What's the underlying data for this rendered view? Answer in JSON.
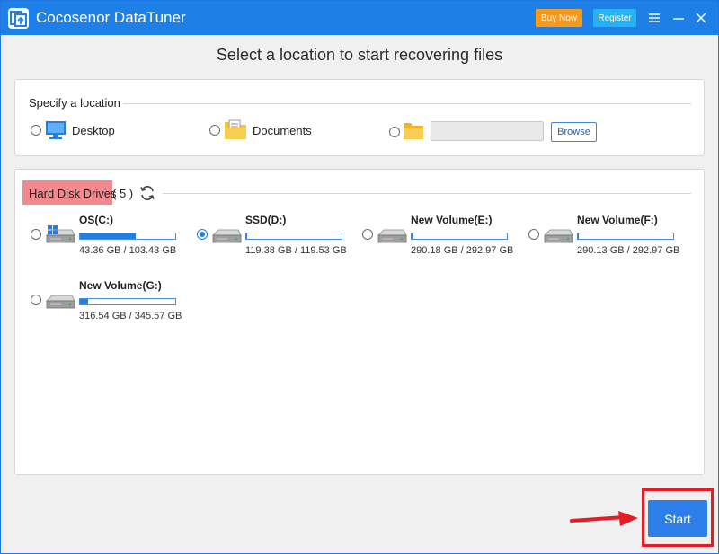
{
  "app": {
    "title": "Cocosenor DataTuner",
    "buy_label": "Buy Now",
    "register_label": "Register"
  },
  "page": {
    "title": "Select a location to start recovering files"
  },
  "location": {
    "section_label": "Specify a location",
    "options": [
      {
        "label": "Desktop",
        "icon": "desktop-icon"
      },
      {
        "label": "Documents",
        "icon": "documents-icon"
      }
    ],
    "path_value": "",
    "browse_label": "Browse"
  },
  "hard_disk": {
    "section_label": "Hard Disk Drives",
    "count_text": "( 5 )",
    "drives": [
      {
        "name": "OS(C:)",
        "size_text": "43.36 GB / 103.43 GB",
        "used_fraction": 0.581,
        "selected": false,
        "os_drive": true
      },
      {
        "name": "SSD(D:)",
        "size_text": "119.38 GB / 119.53 GB",
        "used_fraction": 0.001,
        "selected": true,
        "os_drive": false
      },
      {
        "name": "New Volume(E:)",
        "size_text": "290.18 GB / 292.97 GB",
        "used_fraction": 0.01,
        "selected": false,
        "os_drive": false
      },
      {
        "name": "New Volume(F:)",
        "size_text": "290.13 GB / 292.97 GB",
        "used_fraction": 0.01,
        "selected": false,
        "os_drive": false
      },
      {
        "name": "New Volume(G:)",
        "size_text": "316.54 GB / 345.57 GB",
        "used_fraction": 0.084,
        "selected": false,
        "os_drive": false
      }
    ]
  },
  "footer": {
    "start_label": "Start"
  },
  "colors": {
    "accent": "#1e7fe6",
    "buy": "#f79a1c",
    "register": "#25b1f2",
    "highlight": "#f08a8e",
    "annotation": "#e61c24"
  }
}
